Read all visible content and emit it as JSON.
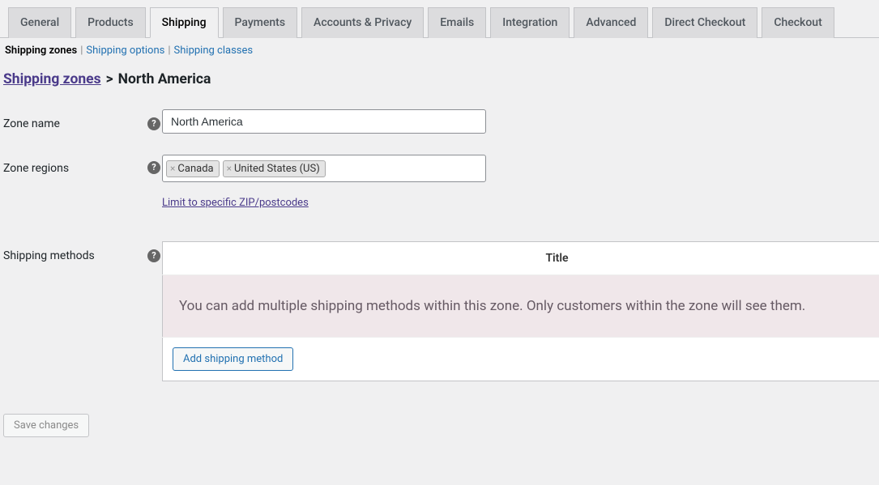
{
  "tabs": {
    "items": [
      "General",
      "Products",
      "Shipping",
      "Payments",
      "Accounts & Privacy",
      "Emails",
      "Integration",
      "Advanced",
      "Direct Checkout",
      "Checkout"
    ],
    "active_index": 2
  },
  "subtabs": {
    "items": [
      "Shipping zones",
      "Shipping options",
      "Shipping classes"
    ],
    "active_index": 0
  },
  "breadcrumb": {
    "root": "Shipping zones",
    "current": "North America"
  },
  "fields": {
    "zone_name": {
      "label": "Zone name",
      "value": "North America"
    },
    "zone_regions": {
      "label": "Zone regions",
      "tags": [
        "Canada",
        "United States (US)"
      ],
      "limit_link": "Limit to specific ZIP/postcodes"
    },
    "shipping_methods": {
      "label": "Shipping methods",
      "header_title": "Title",
      "empty_notice": "You can add multiple shipping methods within this zone. Only customers within the zone will see them.",
      "add_button": "Add shipping method"
    }
  },
  "save_button": "Save changes"
}
